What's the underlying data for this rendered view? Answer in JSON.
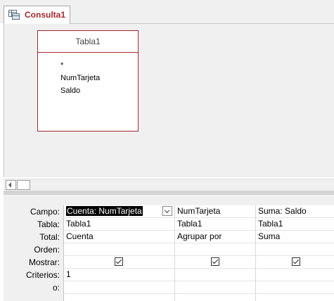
{
  "tab": {
    "label": "Consulta1",
    "icon": "query-icon"
  },
  "table": {
    "title": "Tabla1",
    "fields": [
      "*",
      "NumTarjeta",
      "Saldo"
    ]
  },
  "grid": {
    "row_labels": [
      "Campo:",
      "Tabla:",
      "Total:",
      "Orden:",
      "Mostrar:",
      "Criterios:",
      "o:"
    ],
    "columns": [
      {
        "campo": "Cuenta: NumTarjeta",
        "tabla": "Tabla1",
        "total": "Cuenta",
        "orden": "",
        "mostrar": true,
        "criterios": "1",
        "o": ""
      },
      {
        "campo": "NumTarjeta",
        "tabla": "Tabla1",
        "total": "Agrupar por",
        "orden": "",
        "mostrar": true,
        "criterios": "",
        "o": ""
      },
      {
        "campo": "Suma: Saldo",
        "tabla": "Tabla1",
        "total": "Suma",
        "orden": "",
        "mostrar": true,
        "criterios": "",
        "o": ""
      }
    ]
  },
  "colors": {
    "accent": "#a4262c",
    "pane_bg": "#f0f0f0"
  }
}
